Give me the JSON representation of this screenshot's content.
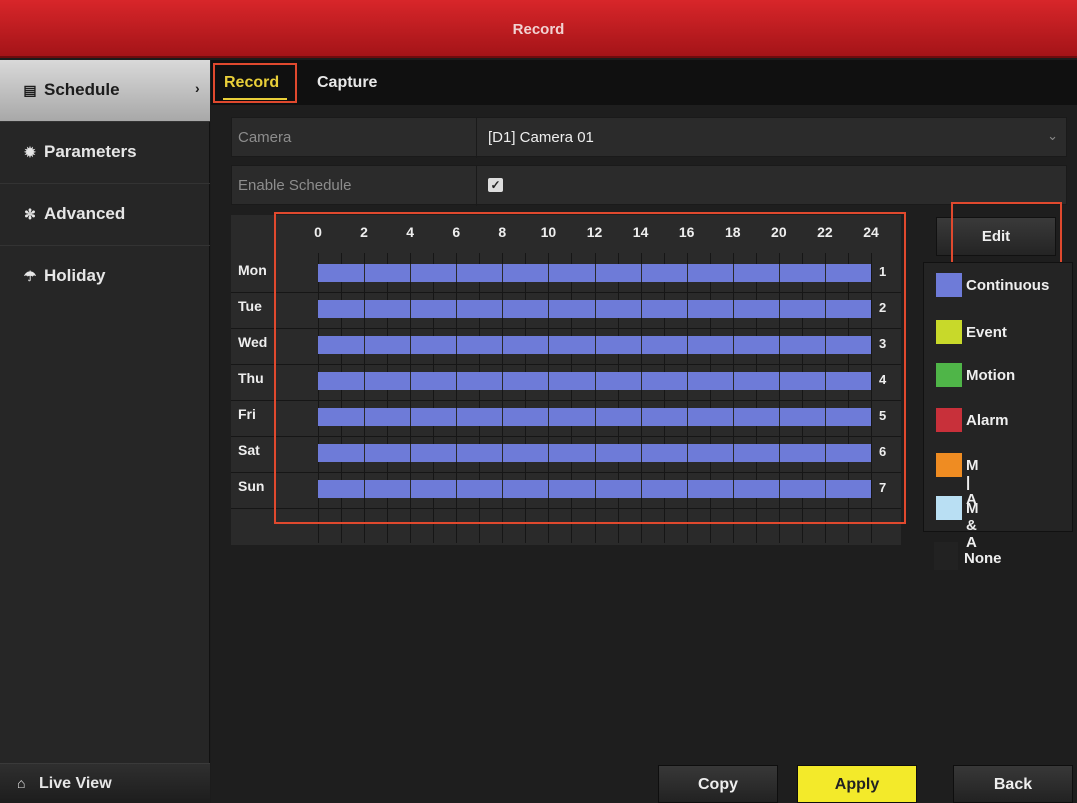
{
  "window": {
    "title": "Record"
  },
  "sidebar": {
    "items": [
      {
        "label": "Schedule",
        "icon": "schedule-icon"
      },
      {
        "label": "Parameters",
        "icon": "gear-icon"
      },
      {
        "label": "Advanced",
        "icon": "advanced-icon"
      },
      {
        "label": "Holiday",
        "icon": "umbrella-icon"
      }
    ],
    "live_view_label": "Live View"
  },
  "tabs": [
    {
      "label": "Record"
    },
    {
      "label": "Capture"
    }
  ],
  "form": {
    "camera_label": "Camera",
    "camera_value": "[D1] Camera 01",
    "enable_label": "Enable Schedule",
    "enable_checked": true
  },
  "schedule": {
    "hours": [
      "0",
      "2",
      "4",
      "6",
      "8",
      "10",
      "12",
      "14",
      "16",
      "18",
      "20",
      "22",
      "24"
    ],
    "days": [
      "Mon",
      "Tue",
      "Wed",
      "Thu",
      "Fri",
      "Sat",
      "Sun"
    ],
    "row_numbers": [
      "1",
      "2",
      "3",
      "4",
      "5",
      "6",
      "7"
    ],
    "record_type": "Continuous",
    "all_day": true
  },
  "edit_label": "Edit",
  "legend": [
    {
      "label": "Continuous",
      "color": "#6e7bd8"
    },
    {
      "label": "Event",
      "color": "#c8d92a"
    },
    {
      "label": "Motion",
      "color": "#4fb548"
    },
    {
      "label": "Alarm",
      "color": "#c8303a"
    },
    {
      "label": "M | A",
      "color": "#ef8c22"
    },
    {
      "label": "M & A",
      "color": "#b9dff3"
    }
  ],
  "legend_none": {
    "label": "None",
    "color": "#222222"
  },
  "buttons": {
    "copy": "Copy",
    "apply": "Apply",
    "back": "Back"
  },
  "colors": {
    "accent": "#e9cf39",
    "title_bar": "#c01e22",
    "apply": "#f3ea2a",
    "highlight_box": "#e0492e"
  }
}
